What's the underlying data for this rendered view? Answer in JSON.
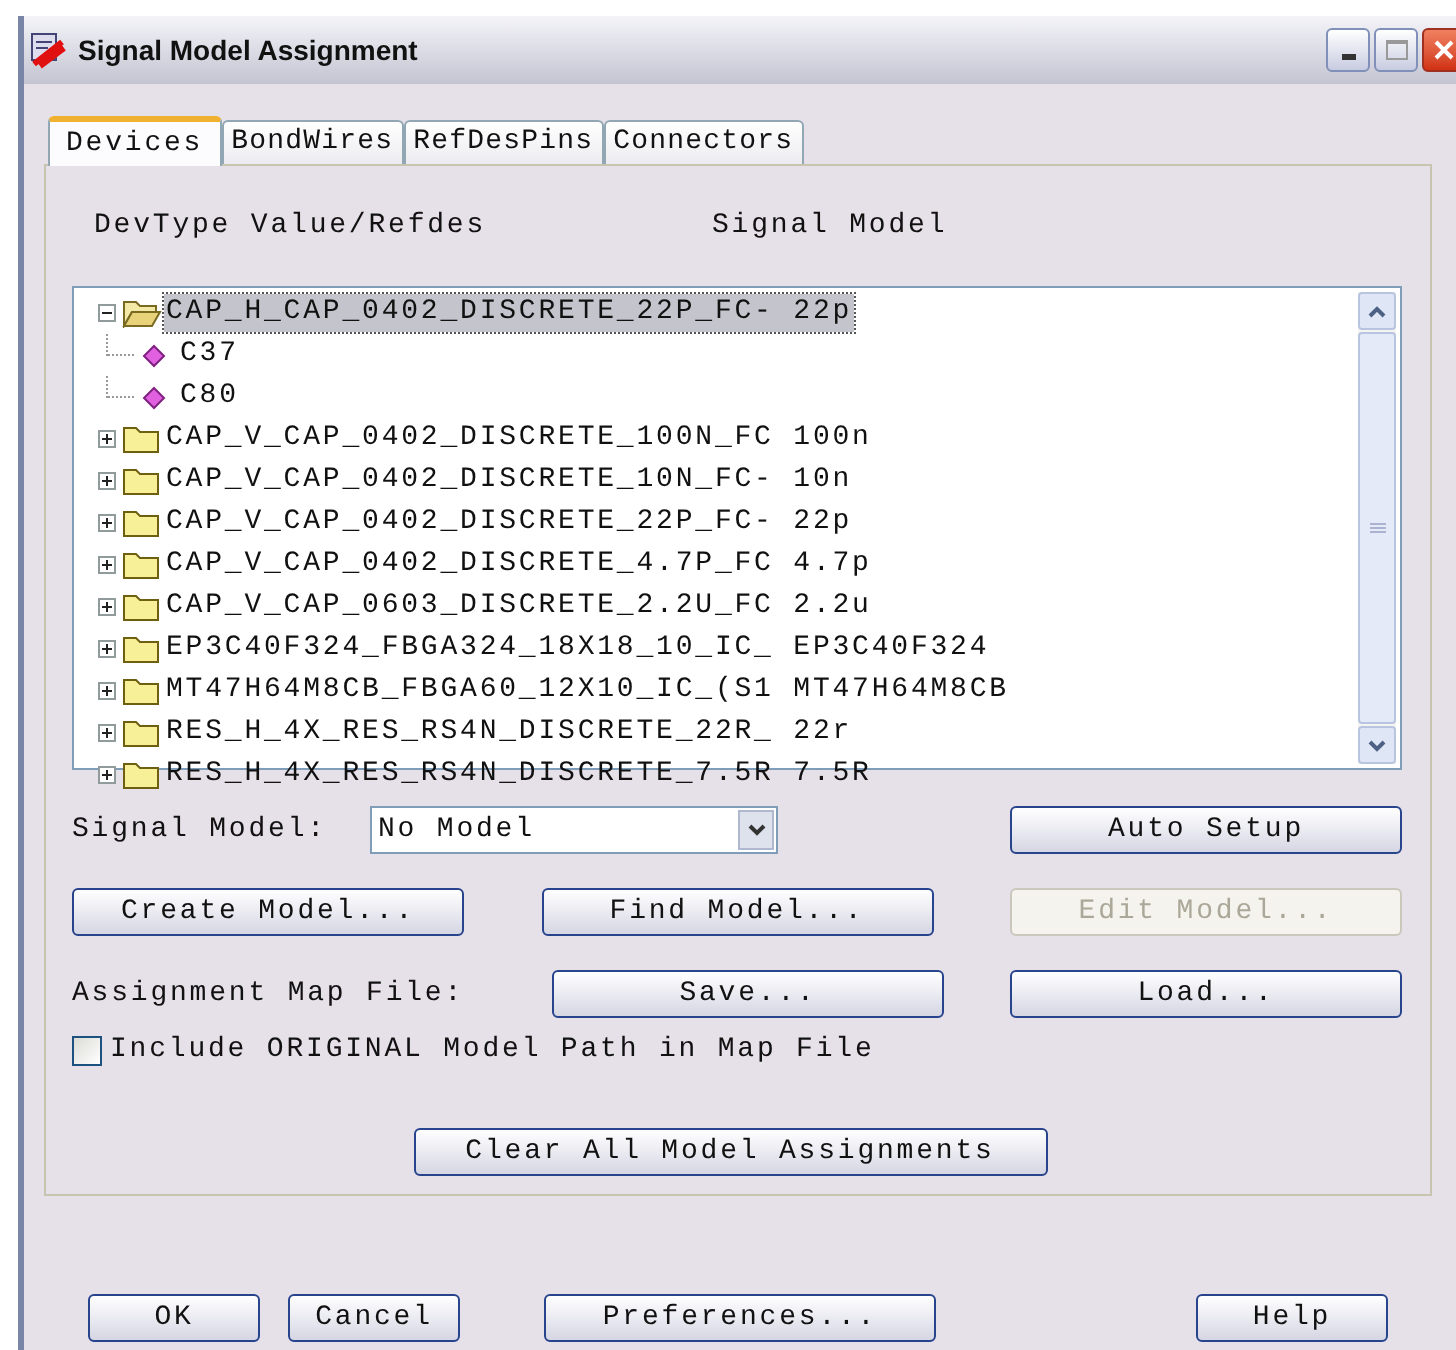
{
  "window": {
    "title": "Signal Model Assignment"
  },
  "tabs": [
    {
      "label": "Devices",
      "selected": true
    },
    {
      "label": "BondWires",
      "selected": false
    },
    {
      "label": "RefDesPins",
      "selected": false
    },
    {
      "label": "Connectors",
      "selected": false
    }
  ],
  "tree_header": {
    "column_1": "DevType Value/Refdes",
    "column_2": "Signal Model"
  },
  "tree": [
    {
      "label": "CAP_H_CAP_0402_DISCRETE_22P_FC- 22p",
      "expanded": true,
      "selected": true,
      "children": [
        {
          "label": "C37",
          "selected": false
        },
        {
          "label": "C80",
          "selected": false
        }
      ]
    },
    {
      "label": "CAP_V_CAP_0402_DISCRETE_100N_FC 100n",
      "expanded": false,
      "selected": false
    },
    {
      "label": "CAP_V_CAP_0402_DISCRETE_10N_FC- 10n",
      "expanded": false,
      "selected": false
    },
    {
      "label": "CAP_V_CAP_0402_DISCRETE_22P_FC- 22p",
      "expanded": false,
      "selected": false
    },
    {
      "label": "CAP_V_CAP_0402_DISCRETE_4.7P_FC 4.7p",
      "expanded": false,
      "selected": false
    },
    {
      "label": "CAP_V_CAP_0603_DISCRETE_2.2U_FC 2.2u",
      "expanded": false,
      "selected": false
    },
    {
      "label": "EP3C40F324_FBGA324_18X18_10_IC_ EP3C40F324",
      "expanded": false,
      "selected": false
    },
    {
      "label": "MT47H64M8CB_FBGA60_12X10_IC_(S1 MT47H64M8CB",
      "expanded": false,
      "selected": false
    },
    {
      "label": "RES_H_4X_RES_RS4N_DISCRETE_22R_ 22r",
      "expanded": false,
      "selected": false
    },
    {
      "label": "RES_H_4X_RES_RS4N_DISCRETE_7.5R 7.5R",
      "expanded": false,
      "selected": false
    }
  ],
  "signal_model": {
    "label": "Signal Model:",
    "value": "No Model"
  },
  "auto_setup": {
    "label": "Auto Setup",
    "disabled": false
  },
  "model_buttons": [
    {
      "label": "Create Model...",
      "disabled": false
    },
    {
      "label": "Find Model...",
      "disabled": false
    },
    {
      "label": "Edit Model...",
      "disabled": true
    }
  ],
  "map_file": {
    "label": "Assignment Map File:",
    "buttons": [
      {
        "label": "Save...",
        "disabled": false
      },
      {
        "label": "Load...",
        "disabled": false
      }
    ]
  },
  "include_original": {
    "label": "Include ORIGINAL Model Path in Map File",
    "checked": false
  },
  "clear_button": {
    "label": "Clear All Model Assignments",
    "disabled": false
  },
  "footer_buttons": [
    {
      "label": "OK",
      "disabled": false
    },
    {
      "label": "Cancel",
      "disabled": false
    },
    {
      "label": "Preferences...",
      "disabled": false
    },
    {
      "label": "Help",
      "disabled": false
    }
  ]
}
